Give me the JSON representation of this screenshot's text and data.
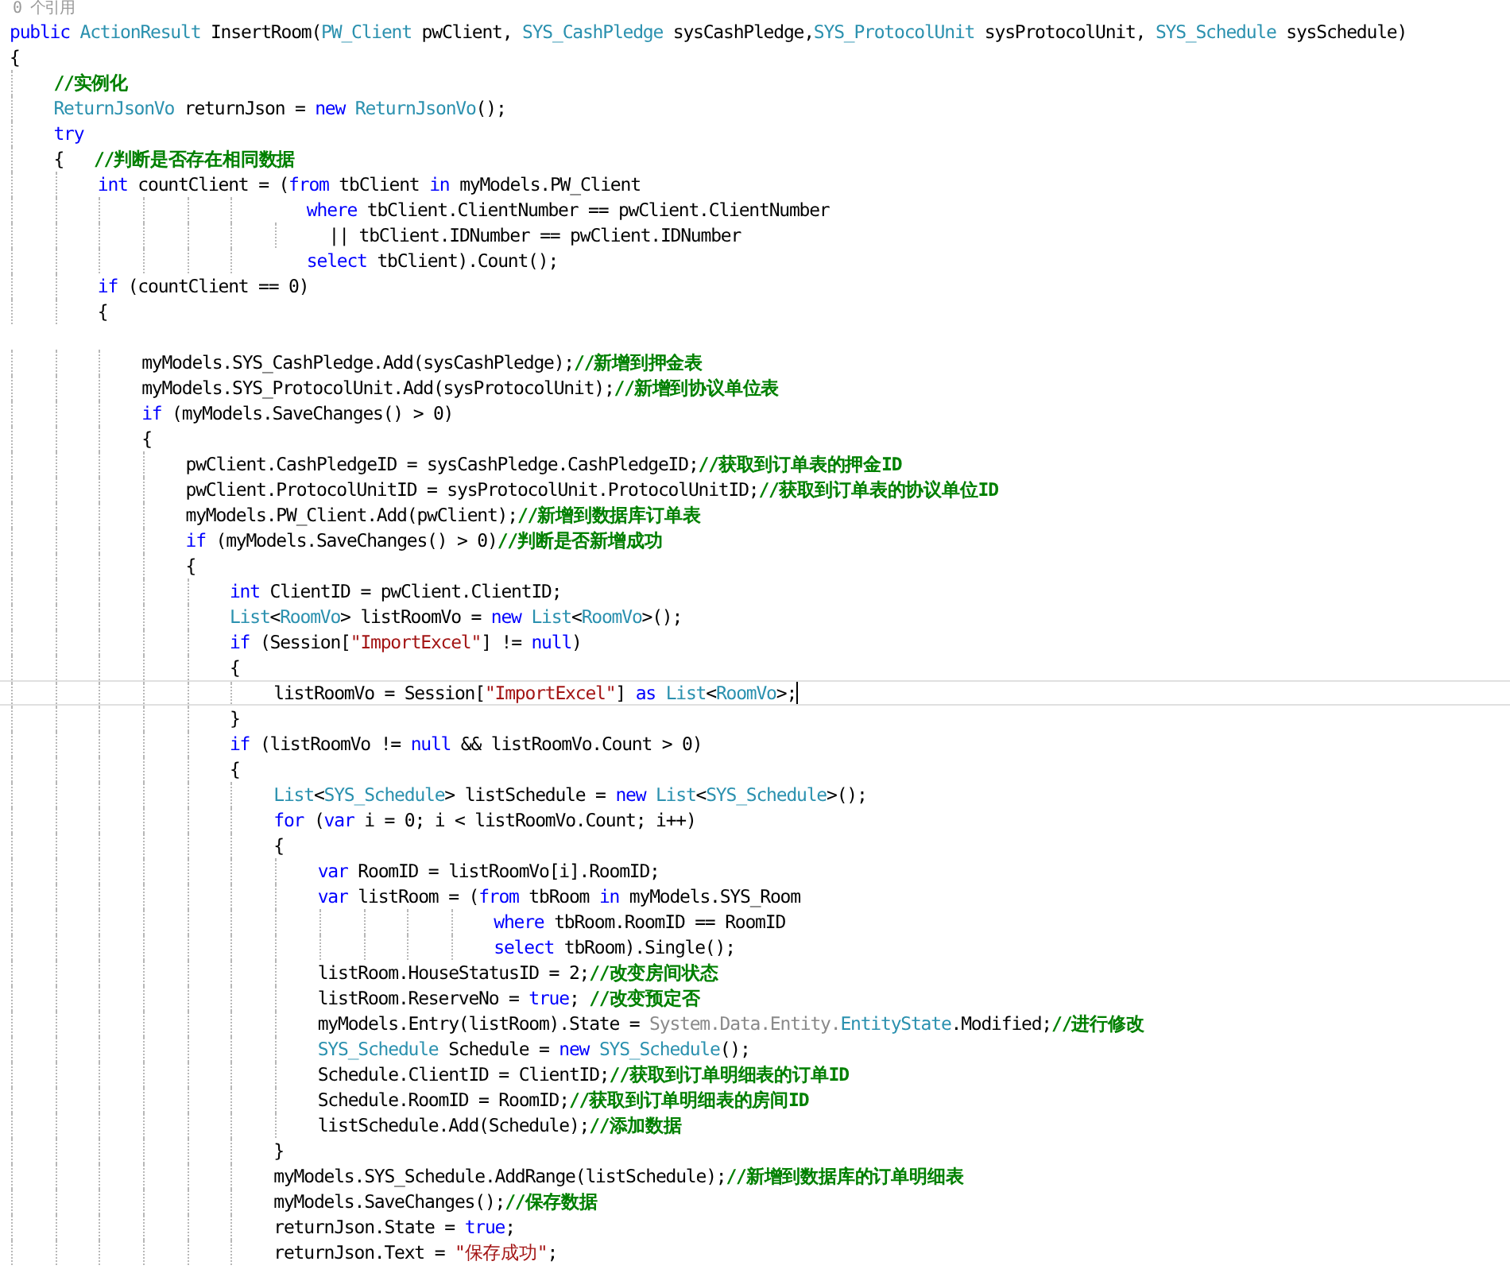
{
  "reference_count": "0 个引用",
  "lines": [
    {
      "current": false,
      "segments": [
        {
          "kind": "keyword",
          "text": "public "
        },
        {
          "kind": "type",
          "text": "ActionResult"
        },
        {
          "kind": "plain",
          "text": " InsertRoom("
        },
        {
          "kind": "type",
          "text": "PW_Client"
        },
        {
          "kind": "plain",
          "text": " pwClient, "
        },
        {
          "kind": "type",
          "text": "SYS_CashPledge"
        },
        {
          "kind": "plain",
          "text": " sysCashPledge,"
        },
        {
          "kind": "type",
          "text": "SYS_ProtocolUnit"
        },
        {
          "kind": "plain",
          "text": " sysProtocolUnit, "
        },
        {
          "kind": "type",
          "text": "SYS_Schedule"
        },
        {
          "kind": "plain",
          "text": " sysSchedule)"
        }
      ]
    },
    {
      "current": false,
      "segments": [
        {
          "kind": "plain",
          "text": "{"
        }
      ]
    },
    {
      "current": false,
      "segments": [
        {
          "kind": "comment",
          "text": "    //实例化"
        }
      ]
    },
    {
      "current": false,
      "segments": [
        {
          "kind": "type",
          "text": "    ReturnJsonVo"
        },
        {
          "kind": "plain",
          "text": " returnJson = "
        },
        {
          "kind": "keyword",
          "text": "new "
        },
        {
          "kind": "type",
          "text": "ReturnJsonVo"
        },
        {
          "kind": "plain",
          "text": "();"
        }
      ]
    },
    {
      "current": false,
      "segments": [
        {
          "kind": "keyword",
          "text": "    try"
        }
      ]
    },
    {
      "current": false,
      "segments": [
        {
          "kind": "plain",
          "text": "    {   "
        },
        {
          "kind": "comment",
          "text": "//判断是否存在相同数据"
        }
      ]
    },
    {
      "current": false,
      "segments": [
        {
          "kind": "keyword",
          "text": "        int"
        },
        {
          "kind": "plain",
          "text": " countClient = ("
        },
        {
          "kind": "keyword",
          "text": "from"
        },
        {
          "kind": "plain",
          "text": " tbClient "
        },
        {
          "kind": "keyword",
          "text": "in"
        },
        {
          "kind": "plain",
          "text": " myModels.PW_Client"
        }
      ]
    },
    {
      "current": false,
      "segments": [
        {
          "kind": "keyword",
          "text": "                           where"
        },
        {
          "kind": "plain",
          "text": " tbClient.ClientNumber == pwClient.ClientNumber"
        }
      ]
    },
    {
      "current": false,
      "segments": [
        {
          "kind": "plain",
          "text": "                             || tbClient.IDNumber == pwClient.IDNumber"
        }
      ]
    },
    {
      "current": false,
      "segments": [
        {
          "kind": "keyword",
          "text": "                           select"
        },
        {
          "kind": "plain",
          "text": " tbClient).Count();"
        }
      ]
    },
    {
      "current": false,
      "segments": [
        {
          "kind": "keyword",
          "text": "        if"
        },
        {
          "kind": "plain",
          "text": " (countClient == 0)"
        }
      ]
    },
    {
      "current": false,
      "segments": [
        {
          "kind": "plain",
          "text": "        {"
        }
      ]
    },
    {
      "current": false
    },
    {
      "current": false,
      "segments": [
        {
          "kind": "plain",
          "text": "            myModels.SYS_CashPledge.Add(sysCashPledge);"
        },
        {
          "kind": "comment",
          "text": "//新增到押金表"
        }
      ]
    },
    {
      "current": false,
      "segments": [
        {
          "kind": "plain",
          "text": "            myModels.SYS_ProtocolUnit.Add(sysProtocolUnit);"
        },
        {
          "kind": "comment",
          "text": "//新增到协议单位表"
        }
      ]
    },
    {
      "current": false,
      "segments": [
        {
          "kind": "keyword",
          "text": "            if"
        },
        {
          "kind": "plain",
          "text": " (myModels.SaveChanges() > 0)"
        }
      ]
    },
    {
      "current": false,
      "segments": [
        {
          "kind": "plain",
          "text": "            {"
        }
      ]
    },
    {
      "current": false,
      "segments": [
        {
          "kind": "plain",
          "text": "                pwClient.CashPledgeID = sysCashPledge.CashPledgeID;"
        },
        {
          "kind": "comment",
          "text": "//获取到订单表的押金ID"
        }
      ]
    },
    {
      "current": false,
      "segments": [
        {
          "kind": "plain",
          "text": "                pwClient.ProtocolUnitID = sysProtocolUnit.ProtocolUnitID;"
        },
        {
          "kind": "comment",
          "text": "//获取到订单表的协议单位ID"
        }
      ]
    },
    {
      "current": false,
      "segments": [
        {
          "kind": "plain",
          "text": "                myModels.PW_Client.Add(pwClient);"
        },
        {
          "kind": "comment",
          "text": "//新增到数据库订单表"
        }
      ]
    },
    {
      "current": false,
      "segments": [
        {
          "kind": "keyword",
          "text": "                if"
        },
        {
          "kind": "plain",
          "text": " (myModels.SaveChanges() > 0)"
        },
        {
          "kind": "comment",
          "text": "//判断是否新增成功"
        }
      ]
    },
    {
      "current": false,
      "segments": [
        {
          "kind": "plain",
          "text": "                {"
        }
      ]
    },
    {
      "current": false,
      "segments": [
        {
          "kind": "keyword",
          "text": "                    int"
        },
        {
          "kind": "plain",
          "text": " ClientID = pwClient.ClientID;"
        }
      ]
    },
    {
      "current": false,
      "segments": [
        {
          "kind": "type",
          "text": "                    List"
        },
        {
          "kind": "plain",
          "text": "<"
        },
        {
          "kind": "type",
          "text": "RoomVo"
        },
        {
          "kind": "plain",
          "text": "> listRoomVo = "
        },
        {
          "kind": "keyword",
          "text": "new "
        },
        {
          "kind": "type",
          "text": "List"
        },
        {
          "kind": "plain",
          "text": "<"
        },
        {
          "kind": "type",
          "text": "RoomVo"
        },
        {
          "kind": "plain",
          "text": ">();"
        }
      ]
    },
    {
      "current": false,
      "segments": [
        {
          "kind": "keyword",
          "text": "                    if"
        },
        {
          "kind": "plain",
          "text": " (Session["
        },
        {
          "kind": "string",
          "text": "\"ImportExcel\""
        },
        {
          "kind": "plain",
          "text": "] != "
        },
        {
          "kind": "keyword",
          "text": "null"
        },
        {
          "kind": "plain",
          "text": ")"
        }
      ]
    },
    {
      "current": false,
      "segments": [
        {
          "kind": "plain",
          "text": "                    {"
        }
      ]
    },
    {
      "current": true,
      "segments": [
        {
          "kind": "plain",
          "text": "                        listRoomVo = Session["
        },
        {
          "kind": "string",
          "text": "\"ImportExcel\""
        },
        {
          "kind": "plain",
          "text": "] "
        },
        {
          "kind": "keyword",
          "text": "as "
        },
        {
          "kind": "type",
          "text": "List"
        },
        {
          "kind": "plain",
          "text": "<"
        },
        {
          "kind": "type",
          "text": "RoomVo"
        },
        {
          "kind": "plain",
          "text": ">;"
        }
      ]
    },
    {
      "current": false,
      "segments": [
        {
          "kind": "plain",
          "text": "                    }"
        }
      ]
    },
    {
      "current": false,
      "segments": [
        {
          "kind": "keyword",
          "text": "                    if"
        },
        {
          "kind": "plain",
          "text": " (listRoomVo != "
        },
        {
          "kind": "keyword",
          "text": "null"
        },
        {
          "kind": "plain",
          "text": " && listRoomVo.Count > 0)"
        }
      ]
    },
    {
      "current": false,
      "segments": [
        {
          "kind": "plain",
          "text": "                    {"
        }
      ]
    },
    {
      "current": false,
      "segments": [
        {
          "kind": "type",
          "text": "                        List"
        },
        {
          "kind": "plain",
          "text": "<"
        },
        {
          "kind": "type",
          "text": "SYS_Schedule"
        },
        {
          "kind": "plain",
          "text": "> listSchedule = "
        },
        {
          "kind": "keyword",
          "text": "new "
        },
        {
          "kind": "type",
          "text": "List"
        },
        {
          "kind": "plain",
          "text": "<"
        },
        {
          "kind": "type",
          "text": "SYS_Schedule"
        },
        {
          "kind": "plain",
          "text": ">();"
        }
      ]
    },
    {
      "current": false,
      "segments": [
        {
          "kind": "keyword",
          "text": "                        for"
        },
        {
          "kind": "plain",
          "text": " ("
        },
        {
          "kind": "keyword",
          "text": "var"
        },
        {
          "kind": "plain",
          "text": " i = 0; i < listRoomVo.Count; i++)"
        }
      ]
    },
    {
      "current": false,
      "segments": [
        {
          "kind": "plain",
          "text": "                        {"
        }
      ]
    },
    {
      "current": false,
      "segments": [
        {
          "kind": "keyword",
          "text": "                            var"
        },
        {
          "kind": "plain",
          "text": " RoomID = listRoomVo[i].RoomID;"
        }
      ]
    },
    {
      "current": false,
      "segments": [
        {
          "kind": "keyword",
          "text": "                            var"
        },
        {
          "kind": "plain",
          "text": " listRoom = ("
        },
        {
          "kind": "keyword",
          "text": "from"
        },
        {
          "kind": "plain",
          "text": " tbRoom "
        },
        {
          "kind": "keyword",
          "text": "in"
        },
        {
          "kind": "plain",
          "text": " myModels.SYS_Room"
        }
      ]
    },
    {
      "current": false,
      "segments": [
        {
          "kind": "keyword",
          "text": "                                            where"
        },
        {
          "kind": "plain",
          "text": " tbRoom.RoomID == RoomID"
        }
      ]
    },
    {
      "current": false,
      "segments": [
        {
          "kind": "keyword",
          "text": "                                            select"
        },
        {
          "kind": "plain",
          "text": " tbRoom).Single();"
        }
      ]
    },
    {
      "current": false,
      "segments": [
        {
          "kind": "plain",
          "text": "                            listRoom.HouseStatusID = 2;"
        },
        {
          "kind": "comment",
          "text": "//改变房间状态"
        }
      ]
    },
    {
      "current": false,
      "segments": [
        {
          "kind": "plain",
          "text": "                            listRoom.ReserveNo = "
        },
        {
          "kind": "keyword",
          "text": "true"
        },
        {
          "kind": "plain",
          "text": "; "
        },
        {
          "kind": "comment",
          "text": "//改变预定否"
        }
      ]
    },
    {
      "current": false,
      "segments": [
        {
          "kind": "plain",
          "text": "                            myModels.Entry(listRoom).State = "
        },
        {
          "kind": "dim",
          "text": "System.Data.Entity."
        },
        {
          "kind": "type",
          "text": "EntityState"
        },
        {
          "kind": "plain",
          "text": ".Modified;"
        },
        {
          "kind": "comment",
          "text": "//进行修改"
        }
      ]
    },
    {
      "current": false,
      "segments": [
        {
          "kind": "type",
          "text": "                            SYS_Schedule"
        },
        {
          "kind": "plain",
          "text": " Schedule = "
        },
        {
          "kind": "keyword",
          "text": "new "
        },
        {
          "kind": "type",
          "text": "SYS_Schedule"
        },
        {
          "kind": "plain",
          "text": "();"
        }
      ]
    },
    {
      "current": false,
      "segments": [
        {
          "kind": "plain",
          "text": "                            Schedule.ClientID = ClientID;"
        },
        {
          "kind": "comment",
          "text": "//获取到订单明细表的订单ID"
        }
      ]
    },
    {
      "current": false,
      "segments": [
        {
          "kind": "plain",
          "text": "                            Schedule.RoomID = RoomID;"
        },
        {
          "kind": "comment",
          "text": "//获取到订单明细表的房间ID"
        }
      ]
    },
    {
      "current": false,
      "segments": [
        {
          "kind": "plain",
          "text": "                            listSchedule.Add(Schedule);"
        },
        {
          "kind": "comment",
          "text": "//添加数据"
        }
      ]
    },
    {
      "current": false,
      "segments": [
        {
          "kind": "plain",
          "text": "                        }"
        }
      ]
    },
    {
      "current": false,
      "segments": [
        {
          "kind": "plain",
          "text": "                        myModels.SYS_Schedule.AddRange(listSchedule);"
        },
        {
          "kind": "comment",
          "text": "//新增到数据库的订单明细表"
        }
      ]
    },
    {
      "current": false,
      "segments": [
        {
          "kind": "plain",
          "text": "                        myModels.SaveChanges();"
        },
        {
          "kind": "comment",
          "text": "//保存数据"
        }
      ]
    },
    {
      "current": false,
      "segments": [
        {
          "kind": "plain",
          "text": "                        returnJson.State = "
        },
        {
          "kind": "keyword",
          "text": "true"
        },
        {
          "kind": "plain",
          "text": ";"
        }
      ]
    },
    {
      "current": false,
      "segments": [
        {
          "kind": "plain",
          "text": "                        returnJson.Text = "
        },
        {
          "kind": "string",
          "text": "\"保存成功\""
        },
        {
          "kind": "plain",
          "text": ";"
        }
      ]
    }
  ]
}
